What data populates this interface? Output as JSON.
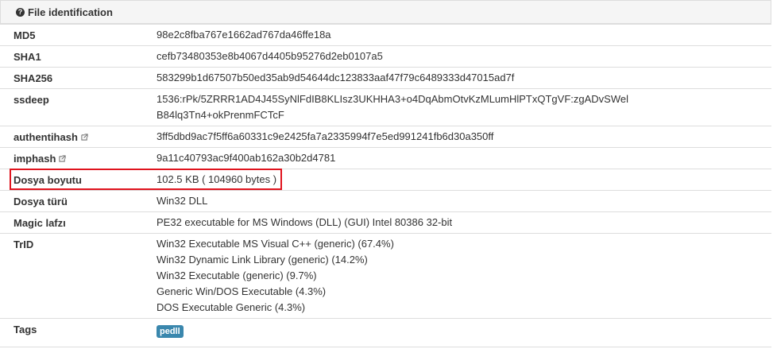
{
  "panel": {
    "title": "File identification",
    "icon": "question-circle-icon"
  },
  "rows": [
    {
      "key": "MD5",
      "value": "98e2c8fba767e1662ad767da46ffe18a"
    },
    {
      "key": "SHA1",
      "value": "cefb73480353e8b4067d4405b95276d2eb0107a5"
    },
    {
      "key": "SHA256",
      "value": "583299b1d67507b50ed35ab9d54644dc123833aaf47f79c6489333d47015ad7f"
    },
    {
      "key": "ssdeep",
      "line1": "1536:rPk/5ZRRR1AD4J45SyNlFdIB8KLIsz3UKHHA3+o4DqAbmOtvKzMLumHlPTxQTgVF:zgADvSWel",
      "line2": "B84lq3Tn4+okPrenmFCTcF"
    },
    {
      "key": "authentihash",
      "value": "3ff5dbd9ac7f5ff6a60331c9e2425fa7a2335994f7e5ed991241fb6d30a350ff",
      "icon": "external-link-icon"
    },
    {
      "key": "imphash",
      "value": "9a11c40793ac9f400ab162a30b2d4781",
      "icon": "external-link-icon"
    },
    {
      "key": "Dosya boyutu",
      "value": "102.5 KB ( 104960 bytes )"
    },
    {
      "key": "Dosya türü",
      "value": "Win32 DLL"
    },
    {
      "key": "Magic lafzı",
      "value": "PE32 executable for MS Windows (DLL) (GUI) Intel 80386 32-bit"
    },
    {
      "key": "TrID",
      "items": [
        "Win32 Executable MS Visual C++ (generic) (67.4%)",
        "Win32 Dynamic Link Library (generic) (14.2%)",
        "Win32 Executable (generic) (9.7%)",
        "Generic Win/DOS Executable (4.3%)",
        "DOS Executable Generic (4.3%)"
      ]
    },
    {
      "key": "Tags",
      "tag": "pedll"
    }
  ],
  "colors": {
    "highlight": "#e0141e",
    "tag_bg": "#3a87ad",
    "border": "#dddddd"
  }
}
